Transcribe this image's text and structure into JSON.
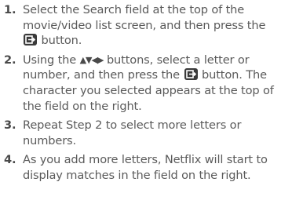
{
  "icons": {
    "enter": "enter-button-icon",
    "arrows": "arrow-buttons-icon"
  },
  "colors": {
    "text": "#5a5a5a",
    "icon_bg": "#3a3a3a"
  },
  "steps": [
    {
      "number": "1.",
      "text_a": "Select the Search field at the top of the movie/video list screen, and then press the",
      "text_b": "button."
    },
    {
      "number": "2.",
      "text_a": "Using the",
      "arrows": "▲▼◀▶",
      "text_b": "buttons, select a letter or number, and then press the",
      "text_c": "button. The character you selected appears at the top of the field on the right."
    },
    {
      "number": "3.",
      "text_a": "Repeat Step 2 to select more letters or numbers."
    },
    {
      "number": "4.",
      "text_a": "As you add more letters, Netflix will start to display matches in the field on the right."
    }
  ]
}
